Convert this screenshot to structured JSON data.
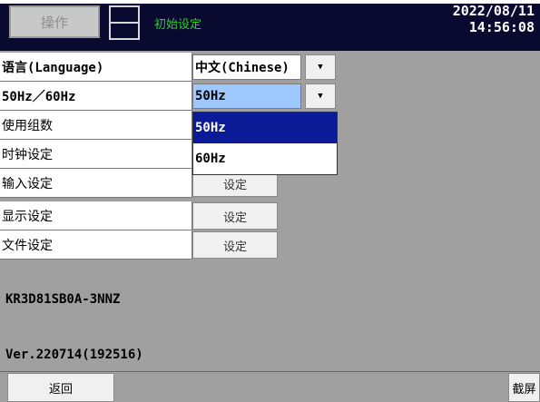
{
  "header": {
    "operate_label": "操作",
    "title": "初始设定",
    "date": "2022/08/11",
    "time": "14:56:08"
  },
  "settings": {
    "language": {
      "label": "语言(Language)",
      "value": "中文(Chinese)"
    },
    "frequency": {
      "label": "50Hz／60Hz",
      "value": "50Hz",
      "options": [
        "50Hz",
        "60Hz"
      ]
    },
    "groups_label": "使用组数",
    "clock_label": "时钟设定",
    "input_label": "输入设定",
    "display_label": "显示设定",
    "file_label": "文件设定",
    "set_button_label": "设定"
  },
  "info": {
    "model": "KR3D81SB0A-3NNZ",
    "version": "Ver.220714(192516)"
  },
  "footer": {
    "back_label": "返回",
    "capture_label": "截屏"
  },
  "colors": {
    "header_bg": "#0a0a30",
    "title_green": "#2ad12a",
    "selected_blue": "#0b1a96",
    "dropdown_highlight": "#9fc8ff",
    "panel_gray": "#a0a0a0"
  }
}
